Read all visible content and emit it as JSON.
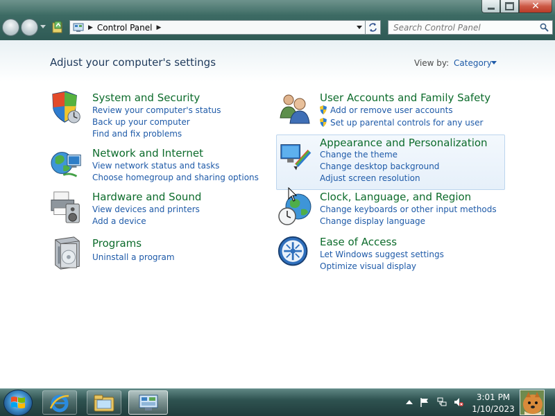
{
  "address": {
    "path": [
      "Control Panel"
    ]
  },
  "search": {
    "placeholder": "Search Control Panel"
  },
  "main": {
    "title": "Adjust your computer's settings",
    "view_by_label": "View by:",
    "view_by_value": "Category"
  },
  "categories": [
    {
      "title": "System and Security",
      "links": [
        "Review your computer's status",
        "Back up your computer",
        "Find and fix problems"
      ]
    },
    {
      "title": "Network and Internet",
      "links": [
        "View network status and tasks",
        "Choose homegroup and sharing options"
      ]
    },
    {
      "title": "Hardware and Sound",
      "links": [
        "View devices and printers",
        "Add a device"
      ]
    },
    {
      "title": "Programs",
      "links": [
        "Uninstall a program"
      ]
    },
    {
      "title": "User Accounts and Family Safety",
      "links": [
        "Add or remove user accounts",
        "Set up parental controls for any user"
      ]
    },
    {
      "title": "Appearance and Personalization",
      "links": [
        "Change the theme",
        "Change desktop background",
        "Adjust screen resolution"
      ]
    },
    {
      "title": "Clock, Language, and Region",
      "links": [
        "Change keyboards or other input methods",
        "Change display language"
      ]
    },
    {
      "title": "Ease of Access",
      "links": [
        "Let Windows suggest settings",
        "Optimize visual display"
      ]
    }
  ],
  "window_controls": {
    "close_glyph": "✕"
  },
  "taskbar": {
    "pinned": [
      "internet-explorer-icon",
      "windows-explorer-icon",
      "control-panel-icon"
    ],
    "tray_icons": [
      "show-hidden-icons",
      "action-center-flag-icon",
      "network-icon",
      "volume-muted-icon"
    ],
    "clock_time": "3:01 PM",
    "clock_date": "1/10/2023"
  },
  "colors": {
    "category_title": "#0c6b2b",
    "link": "#1e5aa8",
    "page_title": "#1e395b",
    "taskbar": "#2f5351",
    "titlebar": "#3c6a63"
  }
}
